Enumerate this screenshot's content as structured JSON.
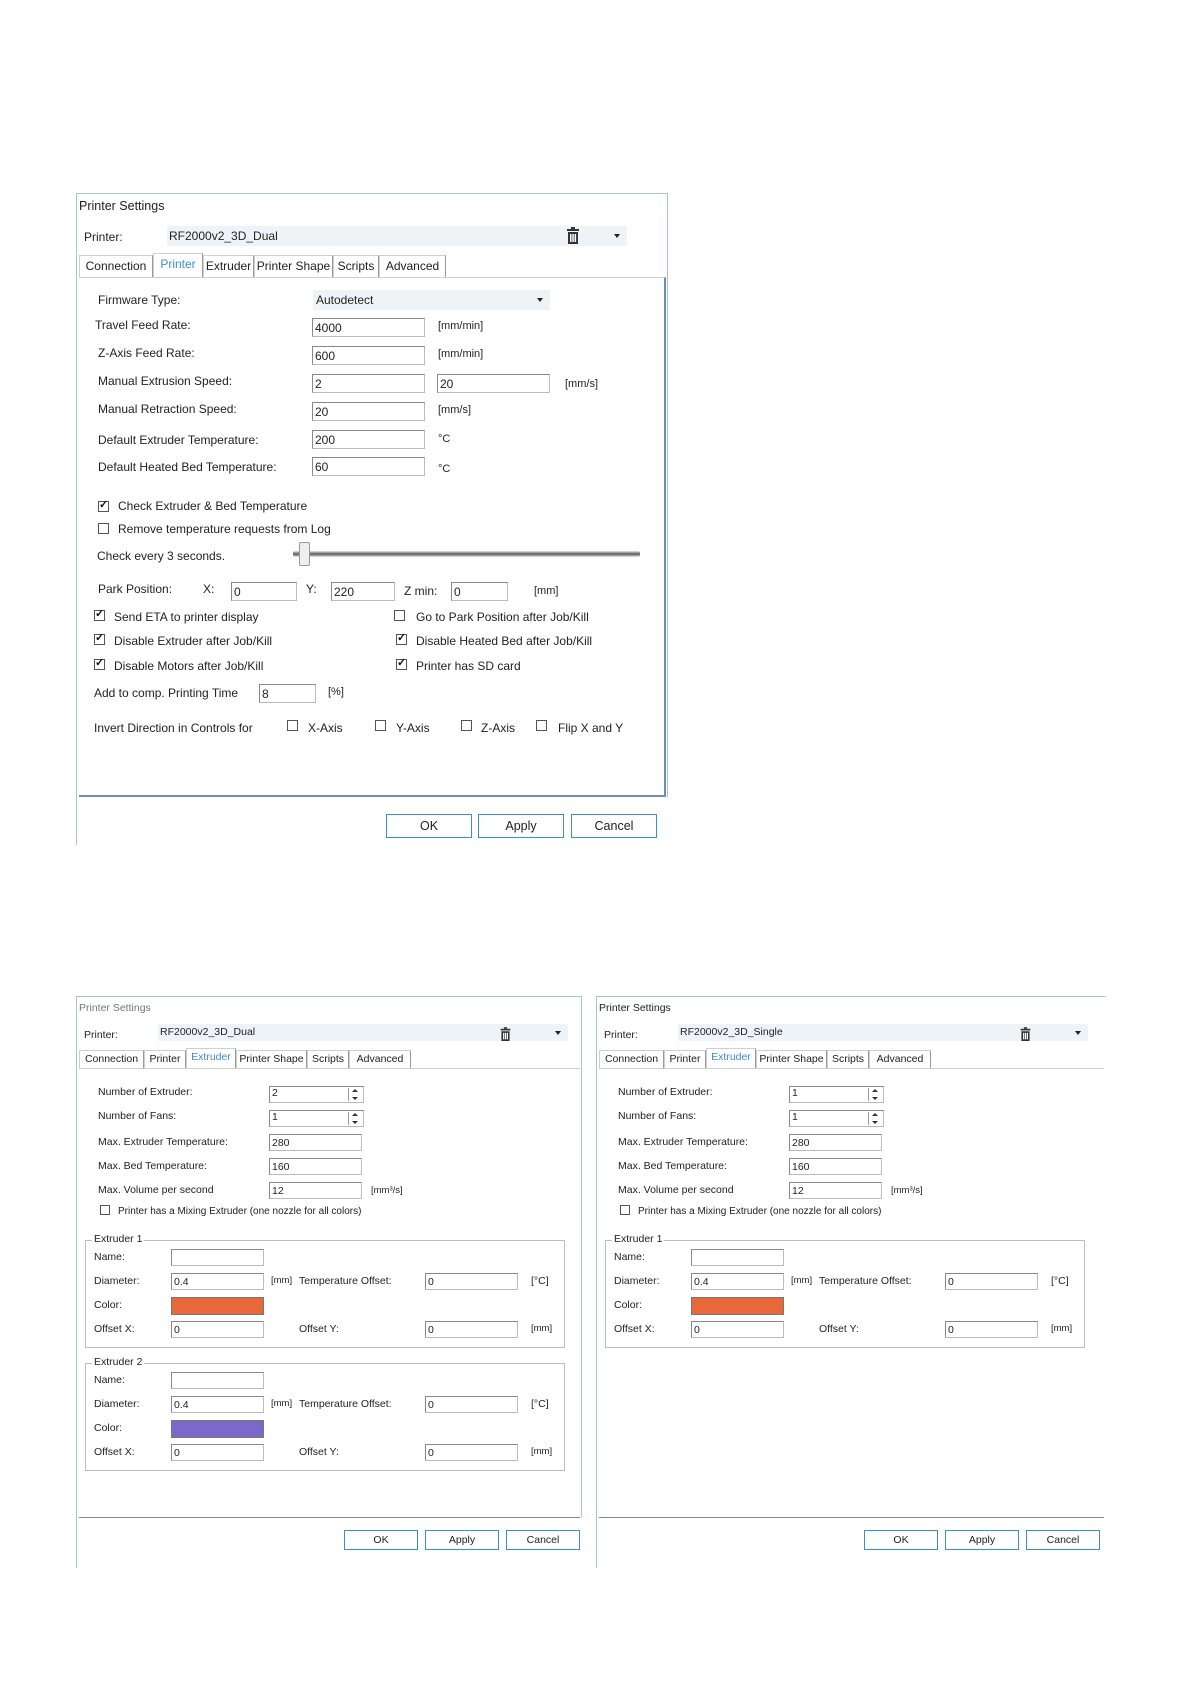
{
  "dialog_top": {
    "title": "Printer Settings",
    "printer_label": "Printer:",
    "printer_value": "RF2000v2_3D_Dual",
    "tabs": [
      "Connection",
      "Printer",
      "Extruder",
      "Printer Shape",
      "Scripts",
      "Advanced"
    ],
    "active_tab": "Printer",
    "firmware_label": "Firmware Type:",
    "firmware_value": "Autodetect",
    "travel_feed_label": "Travel Feed Rate:",
    "travel_feed_value": "4000",
    "travel_feed_unit": "[mm/min]",
    "z_feed_label": "Z-Axis Feed Rate:",
    "z_feed_value": "600",
    "z_feed_unit": "[mm/min]",
    "manual_extrusion_label": "Manual Extrusion Speed:",
    "manual_extrusion_value1": "2",
    "manual_extrusion_value2": "20",
    "manual_extrusion_unit": "[mm/s]",
    "manual_retraction_label": "Manual Retraction Speed:",
    "manual_retraction_value": "20",
    "manual_retraction_unit": "[mm/s]",
    "default_extruder_temp_label": "Default Extruder Temperature:",
    "default_extruder_temp_value": "200",
    "default_extruder_temp_unit": "°C",
    "default_bed_temp_label": "Default Heated Bed Temperature:",
    "default_bed_temp_value": "60",
    "default_bed_temp_unit": "°C",
    "check_temp_label": "Check Extruder & Bed Temperature",
    "check_temp_checked": true,
    "remove_temp_label": "Remove temperature requests from Log",
    "remove_temp_checked": false,
    "check_every_label": "Check every 3 seconds.",
    "check_every_slider_fraction": 0.0,
    "park_label": "Park Position:",
    "park_x_label": "X:",
    "park_x_value": "0",
    "park_y_label": "Y:",
    "park_y_value": "220",
    "park_z_label": "Z min:",
    "park_z_value": "0",
    "park_unit": "[mm]",
    "send_eta_label": "Send ETA to printer display",
    "send_eta_checked": true,
    "goto_park_label": "Go to Park Position after Job/Kill",
    "goto_park_checked": false,
    "disable_extruder_label": "Disable Extruder after Job/Kill",
    "disable_extruder_checked": true,
    "disable_bed_label": "Disable Heated Bed after Job/Kill",
    "disable_bed_checked": true,
    "disable_motors_label": "Disable Motors after Job/Kill",
    "disable_motors_checked": true,
    "sd_card_label": "Printer has SD card",
    "sd_card_checked": true,
    "add_comp_label": "Add to comp. Printing Time",
    "add_comp_value": "8",
    "add_comp_unit": "[%]",
    "invert_label": "Invert Direction in Controls for",
    "invert_x": "X-Axis",
    "invert_y": "Y-Axis",
    "invert_z": "Z-Axis",
    "invert_flip": "Flip X and Y",
    "ok": "OK",
    "apply": "Apply",
    "cancel": "Cancel"
  },
  "dialog_dual": {
    "title": "Printer Settings",
    "printer_label": "Printer:",
    "printer_value": "RF2000v2_3D_Dual",
    "tabs": [
      "Connection",
      "Printer",
      "Extruder",
      "Printer Shape",
      "Scripts",
      "Advanced"
    ],
    "num_extruder_label": "Number of Extruder:",
    "num_extruder_value": "2",
    "num_fans_label": "Number of Fans:",
    "num_fans_value": "1",
    "max_ext_temp_label": "Max. Extruder Temperature:",
    "max_ext_temp_value": "280",
    "max_bed_temp_label": "Max. Bed Temperature:",
    "max_bed_temp_value": "160",
    "max_volume_label": "Max. Volume per second",
    "max_volume_value": "12",
    "max_volume_unit": "[mm³/s]",
    "mixing_label": "Printer has a Mixing Extruder (one nozzle for all colors)",
    "mixing_checked": false,
    "extruders": [
      {
        "title": "Extruder 1",
        "name_label": "Name:",
        "name_value": "",
        "diameter_label": "Diameter:",
        "diameter_value": "0.4",
        "diameter_unit": "[mm]",
        "temp_offset_label": "Temperature Offset:",
        "temp_offset_value": "0",
        "temp_offset_unit": "[°C]",
        "color_label": "Color:",
        "color": "#e8683a",
        "offset_x_label": "Offset X:",
        "offset_x_value": "0",
        "offset_y_label": "Offset Y:",
        "offset_y_value": "0",
        "offset_unit": "[mm]"
      },
      {
        "title": "Extruder 2",
        "name_label": "Name:",
        "name_value": "",
        "diameter_label": "Diameter:",
        "diameter_value": "0.4",
        "diameter_unit": "[mm]",
        "temp_offset_label": "Temperature Offset:",
        "temp_offset_value": "0",
        "temp_offset_unit": "[°C]",
        "color_label": "Color:",
        "color": "#7b68c8",
        "offset_x_label": "Offset X:",
        "offset_x_value": "0",
        "offset_y_label": "Offset Y:",
        "offset_y_value": "0",
        "offset_unit": "[mm]"
      }
    ],
    "ok": "OK",
    "apply": "Apply",
    "cancel": "Cancel"
  },
  "dialog_single": {
    "title": "Printer Settings",
    "printer_label": "Printer:",
    "printer_value": "RF2000v2_3D_Single",
    "tabs": [
      "Connection",
      "Printer",
      "Extruder",
      "Printer Shape",
      "Scripts",
      "Advanced"
    ],
    "num_extruder_label": "Number of Extruder:",
    "num_extruder_value": "1",
    "num_fans_label": "Number of Fans:",
    "num_fans_value": "1",
    "max_ext_temp_label": "Max. Extruder Temperature:",
    "max_ext_temp_value": "280",
    "max_bed_temp_label": "Max. Bed Temperature:",
    "max_bed_temp_value": "160",
    "max_volume_label": "Max. Volume per second",
    "max_volume_value": "12",
    "max_volume_unit": "[mm³/s]",
    "mixing_label": "Printer has a Mixing Extruder (one nozzle for all colors)",
    "mixing_checked": false,
    "extruders": [
      {
        "title": "Extruder 1",
        "name_label": "Name:",
        "name_value": "",
        "diameter_label": "Diameter:",
        "diameter_value": "0.4",
        "diameter_unit": "[mm]",
        "temp_offset_label": "Temperature Offset:",
        "temp_offset_value": "0",
        "temp_offset_unit": "[°C]",
        "color_label": "Color:",
        "color": "#e8683a",
        "offset_x_label": "Offset X:",
        "offset_x_value": "0",
        "offset_y_label": "Offset Y:",
        "offset_y_value": "0",
        "offset_unit": "[mm]"
      }
    ],
    "ok": "OK",
    "apply": "Apply",
    "cancel": "Cancel"
  },
  "colors": {
    "accent": "#3b8ed1",
    "combo_bg": "#eef3f8"
  }
}
